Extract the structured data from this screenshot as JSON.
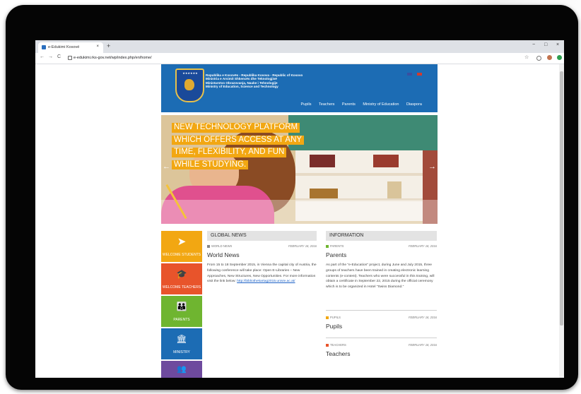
{
  "browser": {
    "tab_title": "e-Edukimi Kosovë",
    "tab_close": "×",
    "new_tab": "+",
    "url": "e-edukimi.rks-gov.net/wp/index.php/en/home/",
    "back": "←",
    "forward": "→",
    "reload": "C",
    "minimize": "−",
    "maximize": "□",
    "close": "×",
    "star": "☆"
  },
  "site": {
    "header_lines": [
      "Republika e Kosovës - Republika Kosova - Republic of Kosovo",
      "Ministria e Arsimit Shkencës dhe Teknologjisë",
      "Ministarstvo Obrazovanja, Nauke i Tehnologije",
      "Ministry of Education, Science and Technology"
    ],
    "emblem_stars": "★★★★★★",
    "nav": [
      "Pupils",
      "Teachers",
      "Parents",
      "Ministry of Education",
      "Diaspora"
    ],
    "hero_lines": [
      "NEW TECHNOLOGY PLATFORM",
      "WHICH OFFERS ACCESS AT ANY",
      "TIME, FLEXIBILITY, AND FUN",
      "WHILE STUDYING."
    ],
    "prev_arrow": "←",
    "next_arrow": "→",
    "tiles": [
      {
        "label": "WELCOME STUDENTS",
        "icon": "paper-plane-icon",
        "glyph": "➤",
        "color": "#f2a712"
      },
      {
        "label": "WELCOME TEACHERS",
        "icon": "graduation-cap-icon",
        "glyph": "🎓",
        "color": "#e8542b"
      },
      {
        "label": "PARENTS",
        "icon": "family-icon",
        "glyph": "👪",
        "color": "#6fb530"
      },
      {
        "label": "MINISTRY",
        "icon": "building-icon",
        "glyph": "🏛",
        "color": "#1c6cb4"
      },
      {
        "label": "",
        "icon": "group-icon",
        "glyph": "👥",
        "color": "#6e4a9e"
      }
    ],
    "global_news": {
      "heading": "GLOBAL NEWS",
      "category": "WORLD NEWS",
      "category_color": "#888888",
      "date": "FEBRUARY 18, 2016",
      "title": "World News",
      "body": "From 15 to 18 September 2015, in Vienna the capital city of Austria, the following conference will take place: Open E-Libraries – New Approaches, New Structures, New Opportunities. For more information visit the link below:",
      "link": "http://bibliothekartag2015.univie.ac.at/"
    },
    "information": {
      "heading": "INFORMATION",
      "items": [
        {
          "category": "PARENTS",
          "category_color": "#6fb530",
          "date": "FEBRUARY 18, 2016",
          "title": "Parents",
          "body": "As part of the \"e-Education\" project, during June and July 2015, three groups of teachers have been trained in creating electronic learning contents (e-content). Teachers who were successful in this training, will obtain a certificate in September 22, 2015 during the official ceremony which is to be organized in Hotel \"Swiss Diamond.\""
        },
        {
          "category": "PUPILS",
          "category_color": "#f2a712",
          "date": "FEBRUARY 18, 2016",
          "title": "Pupils"
        },
        {
          "category": "TEACHERS",
          "category_color": "#e8542b",
          "date": "FEBRUARY 18, 2016",
          "title": "Teachers"
        }
      ]
    }
  }
}
